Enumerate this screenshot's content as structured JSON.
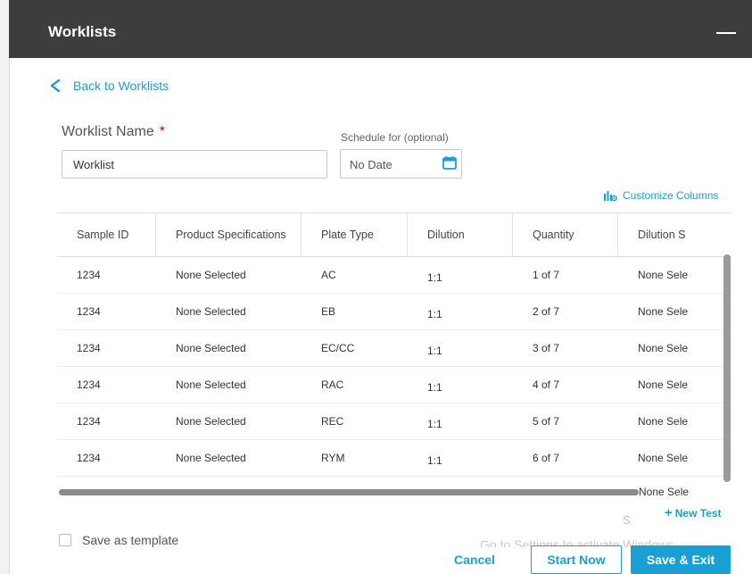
{
  "window": {
    "title": "Worklists"
  },
  "nav": {
    "back_label": "Back to Worklists"
  },
  "form": {
    "name_label": "Worklist Name",
    "required_mark": "*",
    "name_value": "Worklist",
    "schedule_label": "Schedule for (optional)",
    "schedule_value": "No Date"
  },
  "table": {
    "customize_label": "Customize Columns",
    "columns": [
      "Sample ID",
      "Product Specifications",
      "Plate Type",
      "Dilution",
      "Quantity",
      "Dilution S"
    ],
    "rows": [
      [
        "1234",
        "None Selected",
        "AC",
        "1:1",
        "1 of 7",
        "None Sele"
      ],
      [
        "1234",
        "None Selected",
        "EB",
        "1:1",
        "2 of 7",
        "None Sele"
      ],
      [
        "1234",
        "None Selected",
        "EC/CC",
        "1:1",
        "3 of 7",
        "None Sele"
      ],
      [
        "1234",
        "None Selected",
        "RAC",
        "1:1",
        "4 of 7",
        "None Sele"
      ],
      [
        "1234",
        "None Selected",
        "REC",
        "1:1",
        "5 of 7",
        "None Sele"
      ],
      [
        "1234",
        "None Selected",
        "RYM",
        "1:1",
        "6 of 7",
        "None Sele"
      ]
    ],
    "partial_row_last_cell": "None Sele",
    "new_test_label": "New Test"
  },
  "footer": {
    "save_template_label": "Save as template",
    "cancel_label": "Cancel",
    "start_now_label": "Start Now",
    "save_exit_label": "Save & Exit"
  },
  "overlay": {
    "watermark_text": "Go to Settings to activate Windows.",
    "ghost_char": "S"
  },
  "colors": {
    "accent": "#1a9fd5",
    "titlebar": "#3d3d3d",
    "required": "#d0021b"
  }
}
